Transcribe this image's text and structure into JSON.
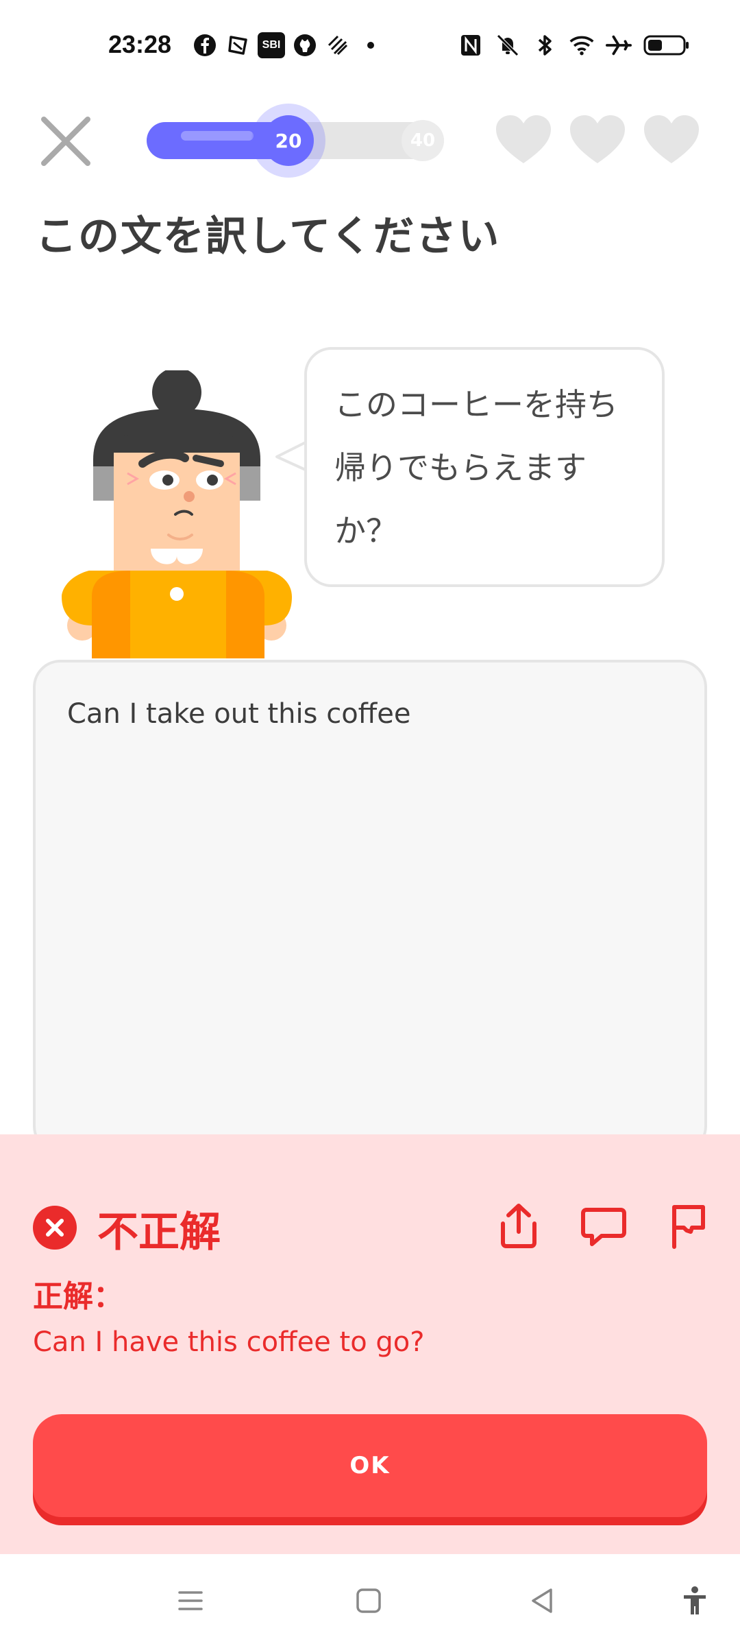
{
  "status_bar": {
    "time": "23:28",
    "left_icons": [
      "facebook-icon",
      "app-icon",
      "sbi-icon",
      "github-icon",
      "app-icon",
      "dot-icon"
    ],
    "sbi_label": "SBI",
    "right_icons": [
      "nfc-icon",
      "mute-icon",
      "bluetooth-icon",
      "wifi-icon",
      "airplane-icon",
      "battery-icon"
    ]
  },
  "lesson": {
    "progress_current": "20",
    "progress_end": "40",
    "progress_fraction": 0.5,
    "hearts_count": 3,
    "prompt_title": "この文を訳してください"
  },
  "speech": {
    "lines": [
      "このコーヒーを持ち",
      "帰りでもらえます",
      "か？"
    ]
  },
  "answer": {
    "user_text": "Can I take out this coffee"
  },
  "feedback": {
    "status": "不正解",
    "correct_label": "正解：",
    "correct_answer": "Can I have this coffee to go?",
    "ok_label": "OK"
  },
  "colors": {
    "progress": "#6c6cff",
    "error": "#ea2b2b",
    "feedback_bg": "#ffdfe0",
    "ok_button": "#ff4b4b"
  }
}
